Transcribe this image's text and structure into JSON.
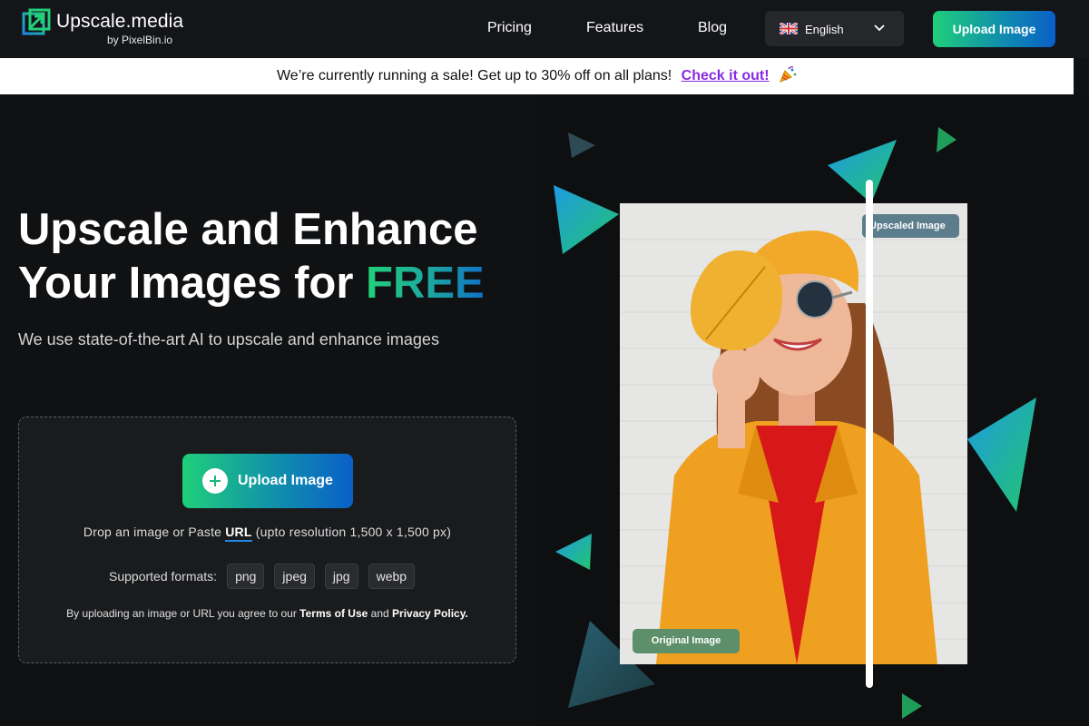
{
  "brand": {
    "name": "Upscale.media",
    "by": "by PixelBin.io"
  },
  "nav": {
    "items": [
      {
        "label": "Pricing"
      },
      {
        "label": "Features"
      },
      {
        "label": "Blog"
      }
    ],
    "language": "English",
    "upload_label": "Upload Image"
  },
  "banner": {
    "text": "We’re currently running a sale! Get up to 30% off on all plans!",
    "link": "Check it out!"
  },
  "hero": {
    "title_line1": "Upscale and Enhance",
    "title_line2_prefix": "Your Images for ",
    "title_highlight": "FREE",
    "subtitle": "We use state-of-the-art AI to upscale and enhance images"
  },
  "upload": {
    "button_label": "Upload Image",
    "drop_prefix": "Drop an image or Paste ",
    "url_label": "URL",
    "drop_suffix": " (upto resolution 1,500 x 1,500 px)",
    "formats_label": "Supported formats:",
    "formats": [
      "png",
      "jpeg",
      "jpg",
      "webp"
    ],
    "terms_prefix": "By uploading an image or URL you agree to our ",
    "terms_link": "Terms of Use",
    "terms_mid": " and ",
    "privacy_link": "Privacy Policy."
  },
  "preview": {
    "upscaled_label": "Upscaled Image",
    "original_label": "Original Image"
  },
  "colors": {
    "accent_green": "#1fcf7a",
    "accent_blue": "#0a5fc8",
    "link_purple": "#8a2be2",
    "background": "#101113"
  },
  "icons": {
    "logo": "upscale-arrow-icon",
    "flag": "uk-flag-icon",
    "dropdown": "chevron-down-icon",
    "upload": "plus-circle-icon",
    "banner": "party-popper-icon"
  }
}
